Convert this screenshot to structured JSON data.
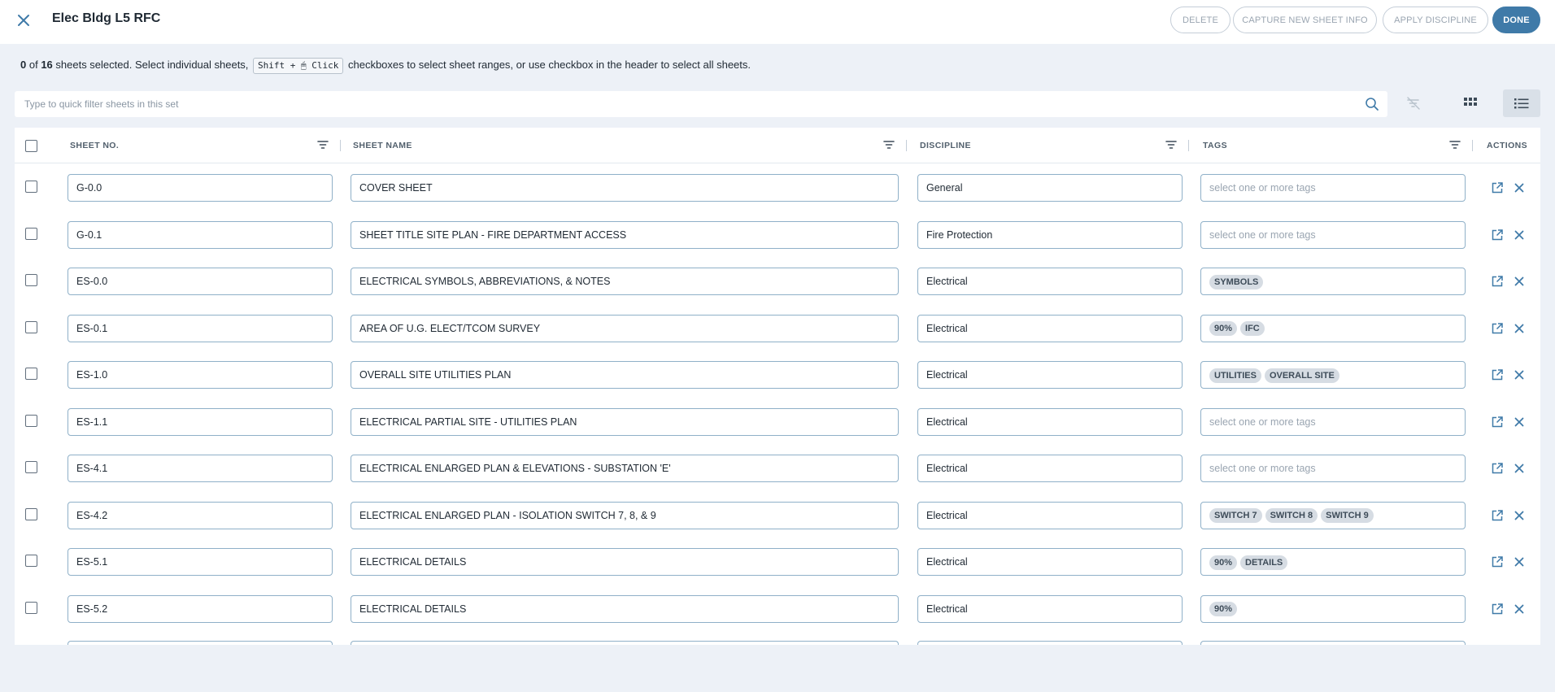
{
  "header": {
    "title": "Elec Bldg L5 RFC",
    "buttons": {
      "delete": "DELETE",
      "capture": "CAPTURE NEW SHEET INFO",
      "apply": "APPLY DISCIPLINE",
      "done": "DONE"
    }
  },
  "selection": {
    "selected": "0",
    "of": " of ",
    "total": "16",
    "text1": " sheets selected. Select individual sheets, ",
    "shortcut": "Shift + 🖱 Click",
    "text2": " checkboxes to select sheet ranges, or use checkbox in the header to select all sheets."
  },
  "filter": {
    "placeholder": "Type to quick filter sheets in this set"
  },
  "columns": {
    "sheet_no": "SHEET NO.",
    "sheet_name": "SHEET NAME",
    "discipline": "DISCIPLINE",
    "tags": "TAGS",
    "actions": "ACTIONS"
  },
  "tags_placeholder": "select one or more tags",
  "rows": [
    {
      "no": "G-0.0",
      "name": "COVER SHEET",
      "discipline": "General",
      "tags": []
    },
    {
      "no": "G-0.1",
      "name": "SHEET TITLE SITE PLAN - FIRE DEPARTMENT ACCESS",
      "discipline": "Fire Protection",
      "tags": []
    },
    {
      "no": "ES-0.0",
      "name": "ELECTRICAL SYMBOLS, ABBREVIATIONS, & NOTES",
      "discipline": "Electrical",
      "tags": [
        "SYMBOLS"
      ]
    },
    {
      "no": "ES-0.1",
      "name": "AREA OF U.G. ELECT/TCOM SURVEY",
      "discipline": "Electrical",
      "tags": [
        "90%",
        "IFC"
      ]
    },
    {
      "no": "ES-1.0",
      "name": "OVERALL SITE UTILITIES PLAN",
      "discipline": "Electrical",
      "tags": [
        "UTILITIES",
        "OVERALL SITE"
      ]
    },
    {
      "no": "ES-1.1",
      "name": "ELECTRICAL PARTIAL SITE - UTILITIES PLAN",
      "discipline": "Electrical",
      "tags": []
    },
    {
      "no": "ES-4.1",
      "name": "ELECTRICAL ENLARGED PLAN & ELEVATIONS - SUBSTATION 'E'",
      "discipline": "Electrical",
      "tags": []
    },
    {
      "no": "ES-4.2",
      "name": "ELECTRICAL ENLARGED PLAN - ISOLATION SWITCH 7, 8, & 9",
      "discipline": "Electrical",
      "tags": [
        "SWITCH 7",
        "SWITCH 8",
        "SWITCH 9"
      ]
    },
    {
      "no": "ES-5.1",
      "name": "ELECTRICAL DETAILS",
      "discipline": "Electrical",
      "tags": [
        "90%",
        "DETAILS"
      ]
    },
    {
      "no": "ES-5.2",
      "name": "ELECTRICAL DETAILS",
      "discipline": "Electrical",
      "tags": [
        "90%"
      ]
    }
  ],
  "icons": {
    "close": "close-icon",
    "search": "search-icon",
    "clear_filter": "filter-off-icon",
    "grid_view": "grid-view-icon",
    "list_view": "list-view-icon",
    "column_filter": "filter-icon",
    "open": "open-external-icon",
    "remove": "close-icon"
  },
  "colors": {
    "accent": "#3f7aa8",
    "background": "#edf1f7",
    "tag_bg": "#d6dce3",
    "field_border": "#8fb0c8"
  }
}
